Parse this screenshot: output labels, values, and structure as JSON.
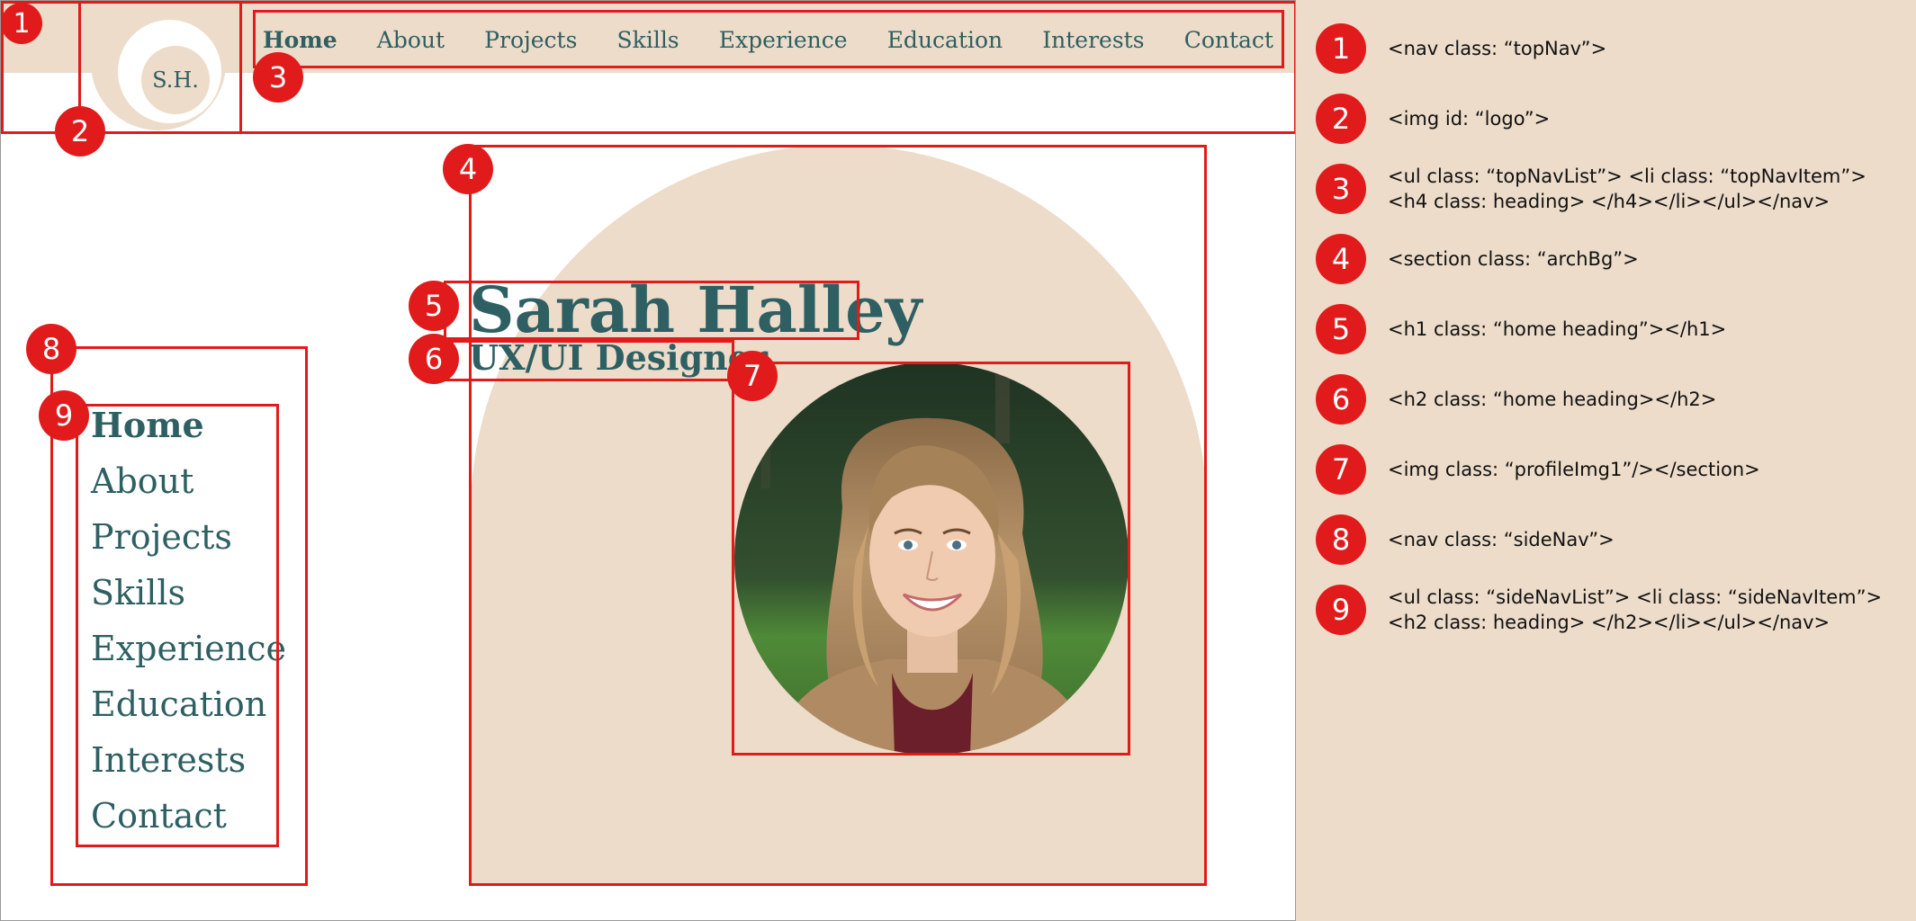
{
  "page": {
    "logo_text": "S.H.",
    "top_nav": [
      "Home",
      "About",
      "Projects",
      "Skills",
      "Experience",
      "Education",
      "Interests",
      "Contact"
    ],
    "hero_name": "Sarah Halley",
    "hero_role": "UX/UI Designer",
    "side_nav": [
      "Home",
      "About",
      "Projects",
      "Skills",
      "Experience",
      "Education",
      "Interests",
      "Contact"
    ],
    "active_item": "Home"
  },
  "legend": [
    {
      "num": "1",
      "lines": [
        "<nav class: “topNav”>"
      ]
    },
    {
      "num": "2",
      "lines": [
        "<img id: “logo”>"
      ]
    },
    {
      "num": "3",
      "lines": [
        "<ul class: “topNavList”> <li class: “topNavItem”>",
        "<h4 class: heading> </h4></li></ul></nav>"
      ]
    },
    {
      "num": "4",
      "lines": [
        "<section class: “archBg”>"
      ]
    },
    {
      "num": "5",
      "lines": [
        "<h1 class: “home heading”></h1>"
      ]
    },
    {
      "num": "6",
      "lines": [
        "<h2 class: “home heading></h2>"
      ]
    },
    {
      "num": "7",
      "lines": [
        "<img class: “profileImg1”/></section>"
      ]
    },
    {
      "num": "8",
      "lines": [
        "<nav class: “sideNav”>"
      ]
    },
    {
      "num": "9",
      "lines": [
        "<ul class: “sideNavList”> <li class: “sideNavItem”>",
        "<h2 class: heading> </h2></li></ul></nav>"
      ]
    }
  ],
  "colors": {
    "beige": "#ecdcc9",
    "teal_text": "#2e5f62",
    "annotation_red": "#e11b1b",
    "page_white": "#ffffff"
  }
}
